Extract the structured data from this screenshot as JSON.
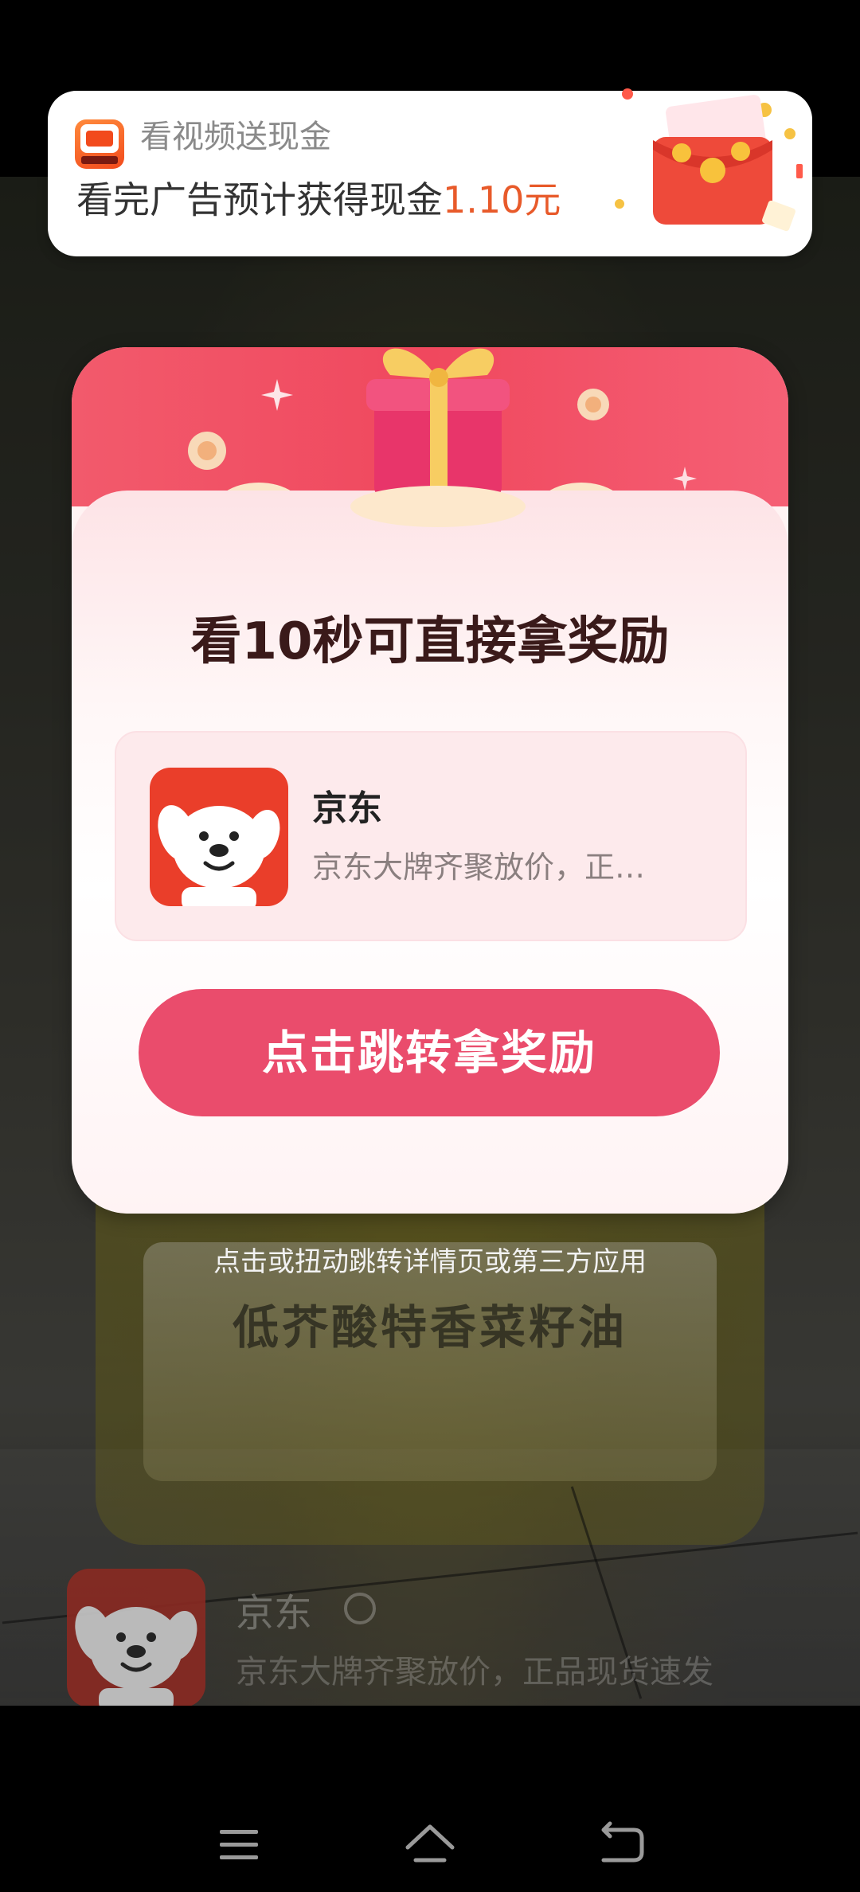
{
  "banner": {
    "app_name": "看视频送现金",
    "message_prefix": "看完广告预计获得现金",
    "amount": "1.10元",
    "app_icon": "manju-app-icon",
    "decor_icon": "red-packet-icon"
  },
  "modal": {
    "title": "看10秒可直接拿奖励",
    "ad": {
      "app_name": "京东",
      "description": "京东大牌齐聚放价，正…",
      "icon": "jd-dog-icon"
    },
    "cta_label": "点击跳转拿奖励",
    "decor_icon": "gift-box-icon"
  },
  "hint": "点击或扭动跳转详情页或第三方应用",
  "video": {
    "label_text": "低芥酸特香菜籽油"
  },
  "advertiser": {
    "name": "京东",
    "description": "京东大牌齐聚放价，正品现货速发",
    "verified_icon": "verified-icon"
  },
  "nav": {
    "menu_icon": "menu-icon",
    "home_icon": "home-icon",
    "back_icon": "back-icon"
  },
  "colors": {
    "accent": "#ea4c6c",
    "amount": "#e85a2a",
    "jd_red": "#ea3e2a"
  }
}
